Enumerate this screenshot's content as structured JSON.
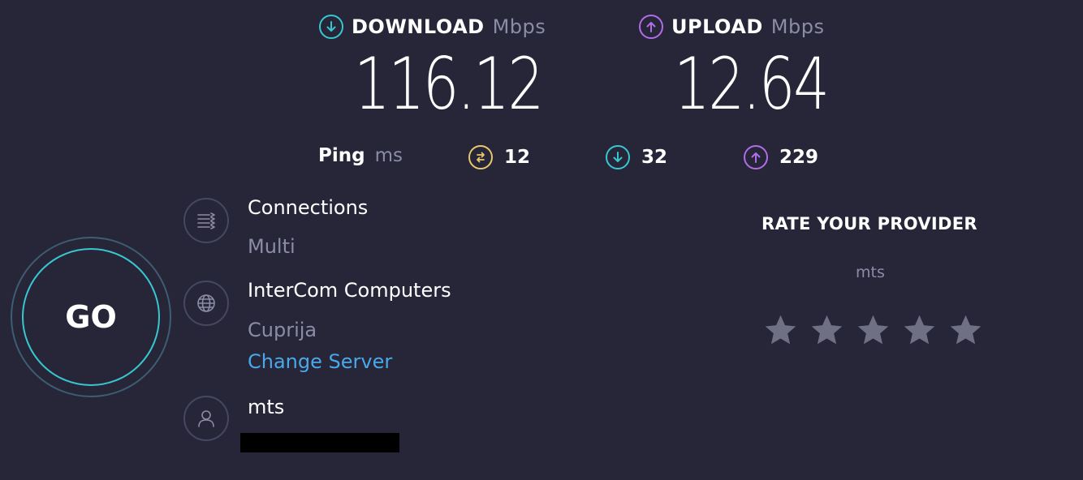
{
  "download": {
    "label": "DOWNLOAD",
    "unit": "Mbps",
    "value": "116.12",
    "color": "#39c6cf"
  },
  "upload": {
    "label": "UPLOAD",
    "unit": "Mbps",
    "value": "12.64",
    "color": "#b26ce8"
  },
  "ping": {
    "label": "Ping",
    "unit": "ms",
    "idle": "12",
    "download": "32",
    "upload": "229",
    "idle_color": "#e8c86a"
  },
  "go_button": {
    "label": "GO"
  },
  "connections": {
    "icon": "connections-icon",
    "title": "Connections",
    "value": "Multi"
  },
  "server": {
    "icon": "globe-icon",
    "name": "InterCom Computers",
    "location": "Cuprija",
    "change_label": "Change Server"
  },
  "provider": {
    "icon": "user-icon",
    "name": "mts"
  },
  "rate": {
    "title": "RATE YOUR PROVIDER",
    "provider": "mts",
    "stars_filled": 0,
    "stars_total": 5,
    "star_color": "#6f7083"
  }
}
